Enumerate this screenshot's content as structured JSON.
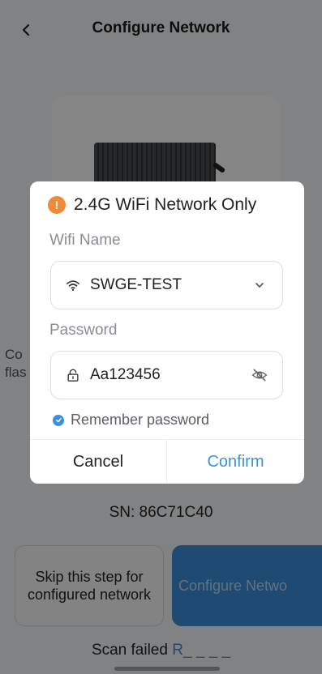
{
  "header": {
    "title": "Configure Network"
  },
  "background": {
    "left_text_line1": "Co",
    "left_text_line2": "flas",
    "sn_text": "SN: 86C71C40",
    "skip_button_label": "Skip this step for configured network",
    "configure_button_label": "Configure Netwo",
    "scan_failed_text": "Scan failed",
    "scan_failed_link": "R_ _ _ _"
  },
  "dialog": {
    "title": "2.4G WiFi Network Only",
    "warning_icon_glyph": "!",
    "wifi_label": "Wifi Name",
    "wifi_value": "SWGE-TEST",
    "password_label": "Password",
    "password_value": "Aa123456",
    "remember_label": "Remember password",
    "remember_checked": true,
    "cancel_label": "Cancel",
    "confirm_label": "Confirm"
  },
  "colors": {
    "accent": "#3c8fd9",
    "warning": "#f08a3a",
    "overlay": "rgba(0,0,0,0.47)"
  },
  "icons": {
    "back": "chevron-left-icon",
    "warning": "warning-icon",
    "wifi": "wifi-icon",
    "dropdown": "chevron-down-icon",
    "lock": "lock-icon",
    "visibility": "eye-off-icon",
    "check": "check-icon"
  }
}
